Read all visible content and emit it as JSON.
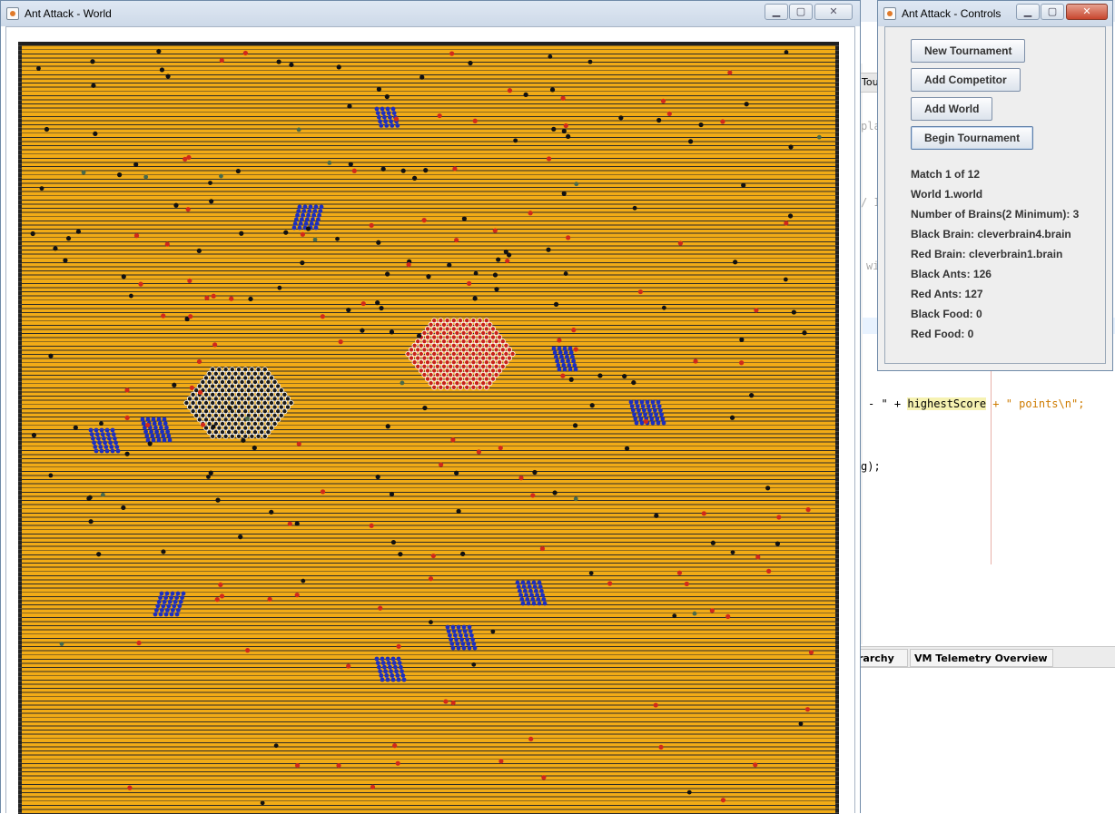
{
  "world_window": {
    "title": "Ant Attack - World"
  },
  "controls_window": {
    "title": "Ant Attack - Controls",
    "buttons": {
      "new_tournament": "New Tournament",
      "add_competitor": "Add Competitor",
      "add_world": "Add World",
      "begin_tournament": "Begin Tournament"
    },
    "info": {
      "match": "Match 1 of 12",
      "world": "World 1.world",
      "num_brains": "Number of Brains(2 Minimum): 3",
      "black_brain": "Black Brain: cleverbrain4.brain",
      "red_brain": "Red Brain: cleverbrain1.brain",
      "black_ants": "Black Ants: 126",
      "red_ants": "Red Ants: 127",
      "black_food": "Black Food: 0",
      "red_food": "Red Food: 0"
    }
  },
  "background_ide": {
    "tab_fragment": "Tou",
    "code_fragments": [
      "pla",
      "/ I",
      "wi"
    ],
    "code_line_1": {
      "prefix": "- \" + ",
      "highlighted": "highestScore",
      "suffix": " + \" points\\n\";"
    },
    "code_line_2": "g);",
    "bottom_tabs": [
      "rarchy",
      "VM Telemetry Overview"
    ]
  },
  "colors": {
    "board": "#f1ab16",
    "rock": "#222222",
    "black_ant": "#111111",
    "red_ant": "#d12a1a",
    "food": "#1c2fc0",
    "marker": "#4a6a4a"
  },
  "icons": {
    "window_icon": "java-app-icon",
    "minimize": "minimize-icon",
    "maximize": "maximize-icon",
    "close": "close-icon"
  }
}
